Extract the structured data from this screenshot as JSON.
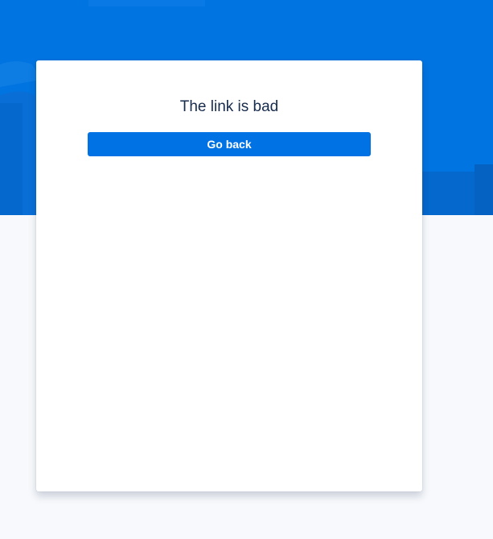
{
  "page": {
    "title": "The link is bad",
    "back_button_label": "Go back"
  },
  "colors": {
    "banner": "#0074e0",
    "button": "#0072e3",
    "title_text": "#172b4d",
    "page_background": "#f7f9fc"
  }
}
